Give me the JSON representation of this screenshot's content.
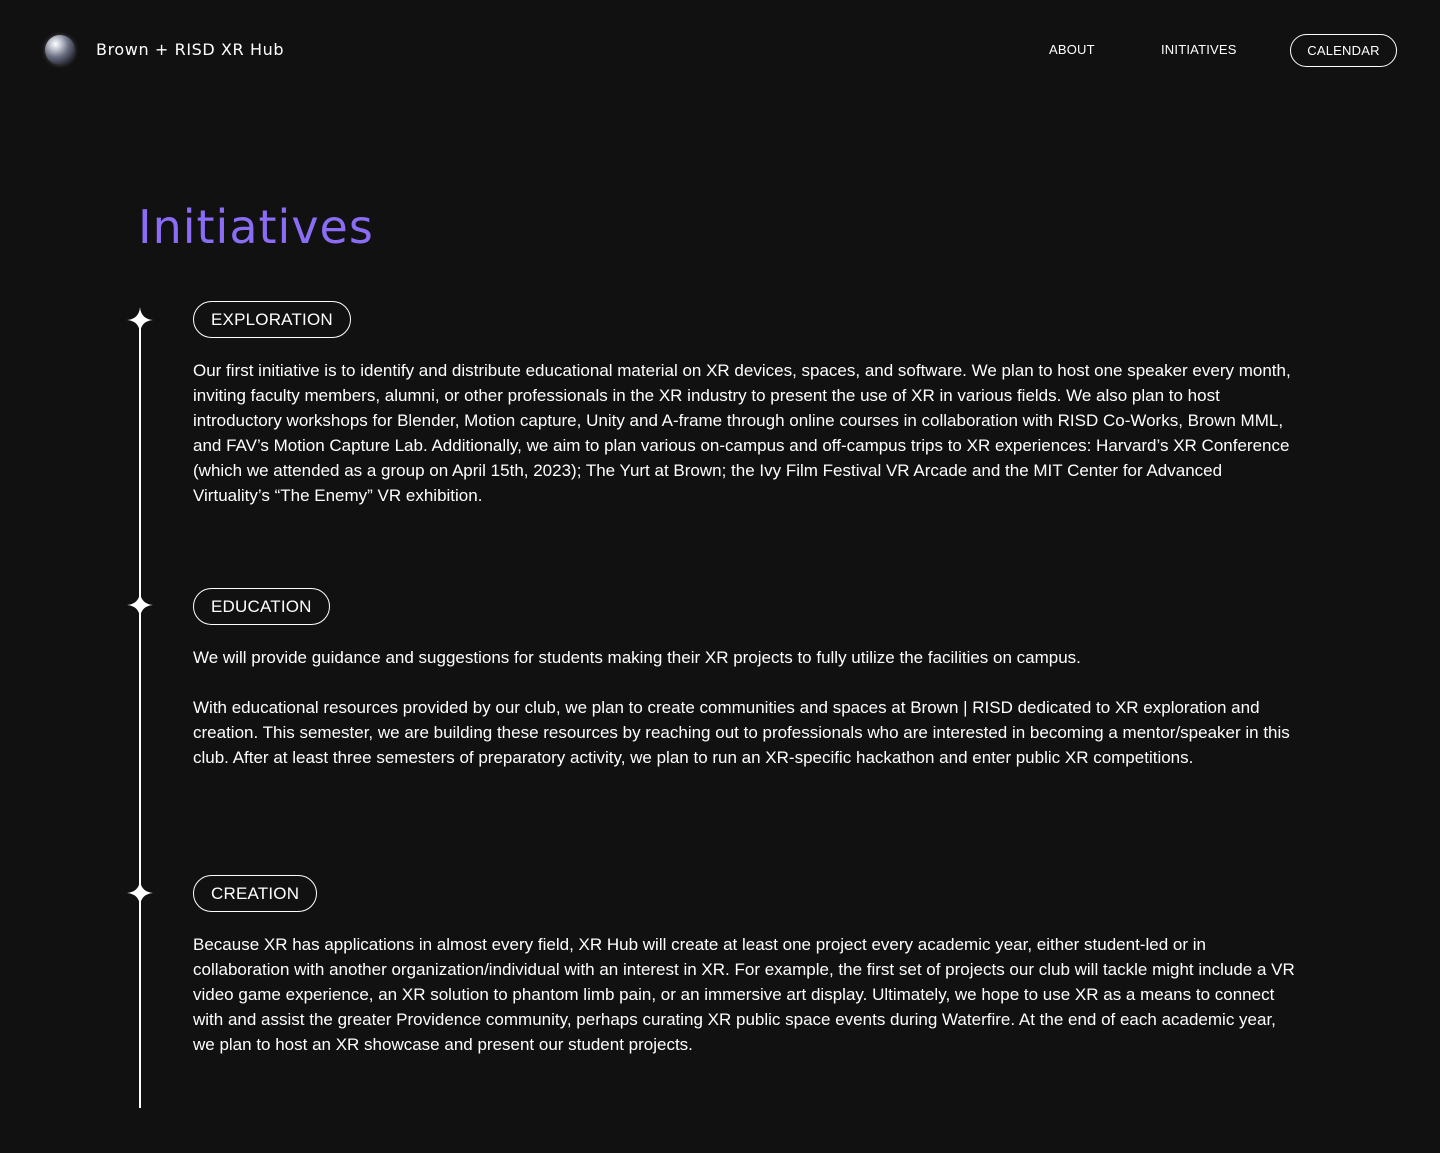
{
  "header": {
    "brand": "Brown + RISD XR Hub",
    "logo_icon": "globe-orb-icon",
    "nav": {
      "about": "ABOUT",
      "initiatives": "INITIATIVES",
      "calendar": "CALENDAR"
    }
  },
  "main": {
    "title": "Initiatives",
    "title_color": "#8a6cf5",
    "sections": [
      {
        "tag": "EXPLORATION",
        "paragraphs": [
          "Our first initiative is to identify and distribute educational material on XR devices, spaces, and software. We plan to host one speaker every month, inviting faculty members, alumni, or other professionals in the XR industry to present the use of XR in various fields. We also plan to host introductory workshops for Blender, Motion capture, Unity and A-frame through online courses in collaboration with RISD Co-Works, Brown MML, and FAV’s Motion Capture Lab. Additionally, we aim to plan various on-campus and off-campus trips to XR experiences: Harvard’s XR Conference (which we attended as a group on April 15th, 2023); The Yurt at Brown; the Ivy Film Festival VR Arcade and the MIT Center for Advanced Virtuality’s “The Enemy” VR exhibition."
        ]
      },
      {
        "tag": "EDUCATION",
        "paragraphs": [
          "We will provide guidance and suggestions for students making their XR projects to fully utilize the facilities on campus.",
          "With educational resources provided by our club, we plan to create communities and spaces at Brown | RISD dedicated to XR exploration and creation. This semester, we are building these resources by reaching out to professionals who are interested in becoming a mentor/speaker in this club. After at least three semesters of preparatory activity, we plan to run an XR-specific hackathon and enter public XR competitions."
        ]
      },
      {
        "tag": "CREATION",
        "paragraphs": [
          "Because XR has applications in almost every field, XR Hub will create at least one project every academic year, either student-led or in collaboration with another organization/individual with an interest in XR. For example, the first set of projects our club will tackle might include a VR video game experience, an XR solution to phantom limb pain, or an immersive art display. Ultimately, we hope to use XR as a means to connect with and assist the greater Providence community, perhaps curating XR public space events during Waterfire. At the end of each academic year, we plan to host an XR showcase and present our student projects."
        ]
      }
    ]
  }
}
